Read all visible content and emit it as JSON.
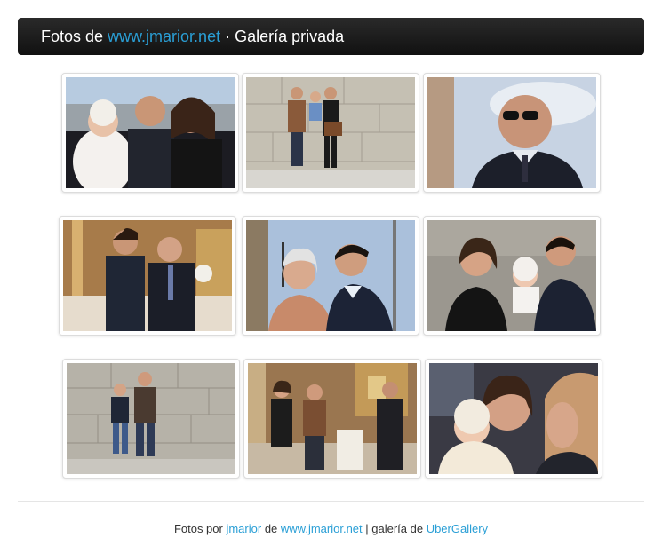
{
  "header": {
    "prefix": "Fotos de ",
    "site_link": "www.jmarior.net",
    "suffix": " · Galería privada"
  },
  "gallery": {
    "photos": [
      {
        "alt": "Foto 1",
        "scene": "outdoor-family-baby"
      },
      {
        "alt": "Foto 2",
        "scene": "stone-wall-family"
      },
      {
        "alt": "Foto 3",
        "scene": "man-sunglasses-sky"
      },
      {
        "alt": "Foto 4",
        "scene": "church-two-men"
      },
      {
        "alt": "Foto 5",
        "scene": "older-woman-man-street"
      },
      {
        "alt": "Foto 6",
        "scene": "couple-baby-stone"
      },
      {
        "alt": "Foto 7",
        "scene": "boys-stone-wall"
      },
      {
        "alt": "Foto 8",
        "scene": "church-altar-group"
      },
      {
        "alt": "Foto 9",
        "scene": "baby-women-closeup"
      }
    ]
  },
  "footer": {
    "text1": "Fotos por ",
    "author_link": "jmarior",
    "text2": " de ",
    "site_link": "www.jmarior.net",
    "text3": " | galería de ",
    "gallery_link": "UberGallery"
  },
  "colors": {
    "link": "#2a9fd6",
    "header_bg": "#1a1a1a"
  }
}
